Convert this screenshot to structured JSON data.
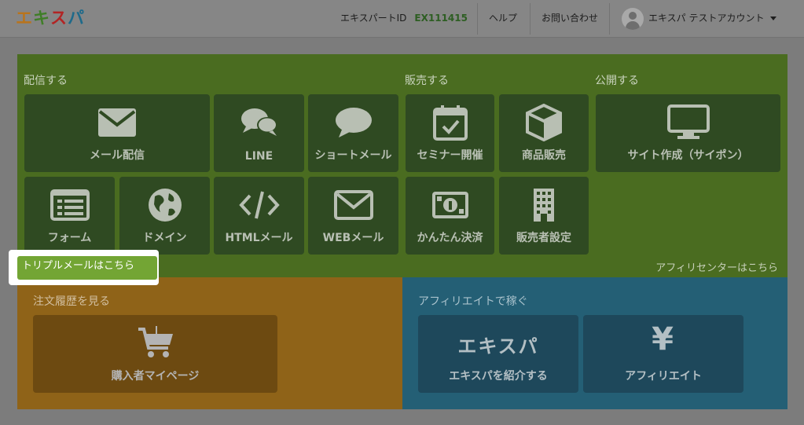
{
  "header": {
    "logo": [
      "エ",
      "キ",
      "ス",
      "パ"
    ],
    "logo_colors": [
      "#b9741c",
      "#3f7e27",
      "#b22424",
      "#1f6a8a"
    ],
    "account_id_label": "エキスパートID",
    "account_id_value": "EX111415",
    "help": "ヘルプ",
    "contact": "お問い合わせ",
    "user_name": "エキスパ テストアカウント"
  },
  "sections": {
    "deliver": "配信する",
    "sell": "販売する",
    "publish": "公開する"
  },
  "tiles": {
    "mail": "メール配信",
    "line": "LINE",
    "sms": "ショートメール",
    "seminar": "セミナー開催",
    "product": "商品販売",
    "site": "サイト作成（サイポン）",
    "form": "フォーム",
    "domain": "ドメイン",
    "html_mail": "HTMLメール",
    "web_mail": "WEBメール",
    "payment": "かんたん決済",
    "seller": "販売者設定"
  },
  "triple_mail_link": "トリプルメールはこちら",
  "affiliate_center_link": "アフィリセンターはこちら",
  "orders": {
    "title": "注文履歴を見る",
    "tile": "購入者マイページ"
  },
  "affiliate": {
    "title": "アフィリエイトで稼ぐ",
    "expa_logo_text": "エキスパ",
    "introduce": "エキスパを紹介する",
    "yen_symbol": "¥",
    "affiliate": "アフィリエイト"
  },
  "colors": {
    "green_panel": "#4a6c20",
    "orange_panel": "#8f6318",
    "blue_panel": "#245f75",
    "highlight": "#73a534"
  }
}
